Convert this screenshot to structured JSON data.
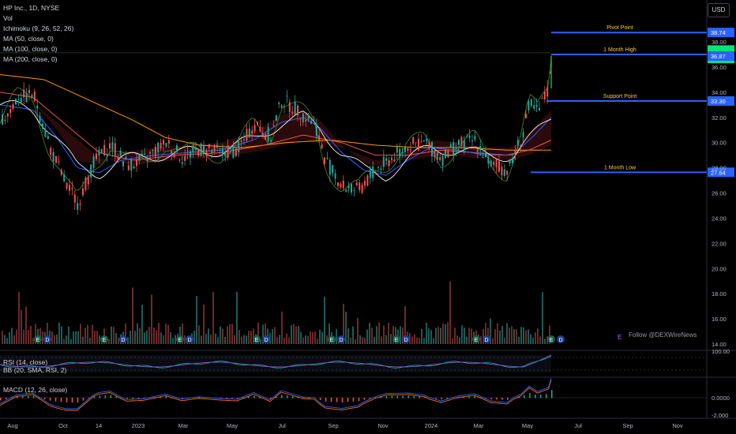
{
  "header": {
    "symbol": "HP Inc., 1D, NYSE",
    "vol": "Vol",
    "ichimoku": "Ichimoku (9, 26, 52, 26)",
    "ma50": "MA (50, close, 0)",
    "ma100": "MA (100, close, 0)",
    "ma200": "MA (200, close, 0)",
    "currency": "USD"
  },
  "rsi_panel": {
    "label": "RSI (14, close)",
    "bb_label": "BB (20, SMA, RSI, 2)",
    "axis_label": "100.00"
  },
  "macd_panel": {
    "label": "MACD (12, 26, close)",
    "axis_labels": [
      "0.0000",
      "-2.000"
    ]
  },
  "watermark": {
    "text": "Follow @DEXWireNews",
    "icon": "E"
  },
  "event_markers": [
    "E",
    "D"
  ],
  "colors": {
    "up": "#26a69a",
    "down": "#ef5350",
    "level": "#2962ff",
    "level_text": "#f5c84c",
    "current": "#00e676",
    "ma50": "#2962ff",
    "ma100": "#ef5350",
    "ma200": "#ff9800"
  },
  "chart_data": {
    "type": "line",
    "title": "HP Inc., 1D, NYSE",
    "x_ticks": [
      "Aug",
      "Oct",
      "14",
      "2023",
      "Mar",
      "May",
      "Jul",
      "Sep",
      "Nov",
      "2024",
      "Mar",
      "May",
      "Jul",
      "Sep",
      "Nov"
    ],
    "y_ticks": [
      38.0,
      36.0,
      34.0,
      32.0,
      30.0,
      28.0,
      26.0,
      24.0,
      22.0,
      20.0,
      18.0,
      16.0,
      14.0
    ],
    "ylim": [
      14,
      39
    ],
    "price_path": [
      {
        "x": 0,
        "y": 31.5
      },
      {
        "x": 0.03,
        "y": 33.5
      },
      {
        "x": 0.06,
        "y": 33.8
      },
      {
        "x": 0.09,
        "y": 29.5
      },
      {
        "x": 0.12,
        "y": 26.5
      },
      {
        "x": 0.14,
        "y": 25.2
      },
      {
        "x": 0.17,
        "y": 28.5
      },
      {
        "x": 0.2,
        "y": 29.8
      },
      {
        "x": 0.23,
        "y": 28.2
      },
      {
        "x": 0.26,
        "y": 28.6
      },
      {
        "x": 0.3,
        "y": 30.0
      },
      {
        "x": 0.33,
        "y": 28.8
      },
      {
        "x": 0.36,
        "y": 29.5
      },
      {
        "x": 0.4,
        "y": 29.2
      },
      {
        "x": 0.43,
        "y": 29.4
      },
      {
        "x": 0.46,
        "y": 31.5
      },
      {
        "x": 0.49,
        "y": 30.5
      },
      {
        "x": 0.51,
        "y": 33.4
      },
      {
        "x": 0.54,
        "y": 32.5
      },
      {
        "x": 0.57,
        "y": 31.5
      },
      {
        "x": 0.59,
        "y": 28.5
      },
      {
        "x": 0.62,
        "y": 26.5
      },
      {
        "x": 0.65,
        "y": 26.2
      },
      {
        "x": 0.68,
        "y": 27.8
      },
      {
        "x": 0.71,
        "y": 28.8
      },
      {
        "x": 0.74,
        "y": 29.8
      },
      {
        "x": 0.77,
        "y": 30.0
      },
      {
        "x": 0.8,
        "y": 28.7
      },
      {
        "x": 0.83,
        "y": 29.8
      },
      {
        "x": 0.86,
        "y": 30.2
      },
      {
        "x": 0.89,
        "y": 28.2
      },
      {
        "x": 0.92,
        "y": 27.8
      },
      {
        "x": 0.945,
        "y": 30.5
      },
      {
        "x": 0.96,
        "y": 33.1
      },
      {
        "x": 0.975,
        "y": 32.4
      },
      {
        "x": 0.985,
        "y": 33.4
      },
      {
        "x": 0.995,
        "y": 34.4
      },
      {
        "x": 1.0,
        "y": 36.9
      }
    ],
    "ma50": [
      {
        "x": 0,
        "y": 33.0
      },
      {
        "x": 0.06,
        "y": 32.6
      },
      {
        "x": 0.1,
        "y": 30.6
      },
      {
        "x": 0.14,
        "y": 28.0
      },
      {
        "x": 0.18,
        "y": 27.6
      },
      {
        "x": 0.22,
        "y": 28.6
      },
      {
        "x": 0.28,
        "y": 29.0
      },
      {
        "x": 0.34,
        "y": 29.2
      },
      {
        "x": 0.4,
        "y": 29.4
      },
      {
        "x": 0.46,
        "y": 30.2
      },
      {
        "x": 0.51,
        "y": 31.6
      },
      {
        "x": 0.55,
        "y": 32.0
      },
      {
        "x": 0.58,
        "y": 31.2
      },
      {
        "x": 0.62,
        "y": 29.2
      },
      {
        "x": 0.66,
        "y": 27.8
      },
      {
        "x": 0.7,
        "y": 27.4
      },
      {
        "x": 0.74,
        "y": 28.6
      },
      {
        "x": 0.78,
        "y": 29.6
      },
      {
        "x": 0.83,
        "y": 29.4
      },
      {
        "x": 0.88,
        "y": 29.0
      },
      {
        "x": 0.93,
        "y": 29.0
      },
      {
        "x": 0.97,
        "y": 30.6
      },
      {
        "x": 1.0,
        "y": 32.0
      }
    ],
    "ma100": [
      {
        "x": 0,
        "y": 34.0
      },
      {
        "x": 0.06,
        "y": 33.6
      },
      {
        "x": 0.12,
        "y": 31.4
      },
      {
        "x": 0.18,
        "y": 29.2
      },
      {
        "x": 0.24,
        "y": 28.6
      },
      {
        "x": 0.32,
        "y": 29.0
      },
      {
        "x": 0.4,
        "y": 29.2
      },
      {
        "x": 0.48,
        "y": 29.8
      },
      {
        "x": 0.55,
        "y": 30.6
      },
      {
        "x": 0.62,
        "y": 30.0
      },
      {
        "x": 0.68,
        "y": 29.0
      },
      {
        "x": 0.74,
        "y": 29.0
      },
      {
        "x": 0.8,
        "y": 29.4
      },
      {
        "x": 0.86,
        "y": 29.2
      },
      {
        "x": 0.92,
        "y": 29.0
      },
      {
        "x": 0.96,
        "y": 29.4
      },
      {
        "x": 1.0,
        "y": 30.2
      }
    ],
    "ma200": [
      {
        "x": 0,
        "y": 35.4
      },
      {
        "x": 0.08,
        "y": 35.0
      },
      {
        "x": 0.16,
        "y": 33.4
      },
      {
        "x": 0.24,
        "y": 31.8
      },
      {
        "x": 0.3,
        "y": 30.4
      },
      {
        "x": 0.36,
        "y": 29.8
      },
      {
        "x": 0.44,
        "y": 29.6
      },
      {
        "x": 0.52,
        "y": 30.0
      },
      {
        "x": 0.6,
        "y": 30.2
      },
      {
        "x": 0.68,
        "y": 29.8
      },
      {
        "x": 0.76,
        "y": 29.6
      },
      {
        "x": 0.84,
        "y": 29.6
      },
      {
        "x": 0.92,
        "y": 29.4
      },
      {
        "x": 1.0,
        "y": 29.4
      }
    ],
    "levels": [
      {
        "label": "Pivot Point",
        "price": 38.74,
        "price_label": "38.74",
        "color": "#2962ff"
      },
      {
        "label": "1 Month High",
        "price": 37.0,
        "price_label": "",
        "color": "#2962ff"
      },
      {
        "label": "Support Point",
        "price": 33.3,
        "price_label": "33.30",
        "color": "#2962ff"
      },
      {
        "label": "1 Month Low",
        "price": 27.64,
        "price_label": "27.64",
        "color": "#2962ff"
      }
    ],
    "current_price": {
      "price": 36.87,
      "label": "36.87"
    },
    "xlabel": "",
    "ylabel": ""
  }
}
